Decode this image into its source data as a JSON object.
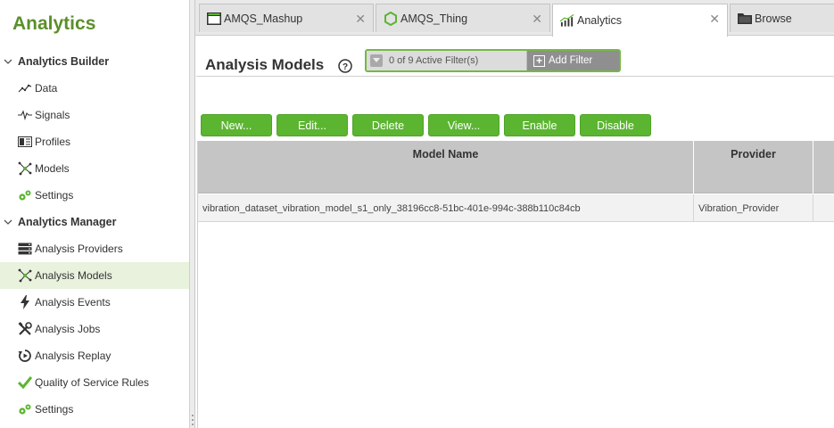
{
  "sidebar": {
    "title": "Analytics",
    "sections": [
      {
        "label": "Analytics Builder",
        "items": [
          {
            "label": "Data",
            "icon": "data-icon"
          },
          {
            "label": "Signals",
            "icon": "signals-icon"
          },
          {
            "label": "Profiles",
            "icon": "profiles-icon"
          },
          {
            "label": "Models",
            "icon": "models-icon"
          },
          {
            "label": "Settings",
            "icon": "settings-icon"
          }
        ]
      },
      {
        "label": "Analytics Manager",
        "items": [
          {
            "label": "Analysis Providers",
            "icon": "providers-icon"
          },
          {
            "label": "Analysis Models",
            "icon": "models-icon",
            "active": true
          },
          {
            "label": "Analysis Events",
            "icon": "lightning-icon"
          },
          {
            "label": "Analysis Jobs",
            "icon": "tools-icon"
          },
          {
            "label": "Analysis Replay",
            "icon": "replay-icon"
          },
          {
            "label": "Quality of Service Rules",
            "icon": "checkmark-icon"
          },
          {
            "label": "Settings",
            "icon": "settings-icon"
          }
        ]
      }
    ]
  },
  "tabs": [
    {
      "label": "AMQS_Mashup",
      "icon": "mashup-icon"
    },
    {
      "label": "AMQS_Thing",
      "icon": "thing-icon"
    },
    {
      "label": "Analytics",
      "icon": "analytics-icon",
      "active": true
    },
    {
      "label": "Browse",
      "icon": "folder-icon"
    }
  ],
  "page": {
    "title": "Analysis Models",
    "filter": {
      "count_text": "0 of 9 Active Filter(s)",
      "add_label": "Add Filter"
    },
    "buttons": {
      "new": "New...",
      "edit": "Edit...",
      "delete": "Delete",
      "view": "View...",
      "enable": "Enable",
      "disable": "Disable"
    },
    "grid": {
      "columns": [
        "Model Name",
        "Provider"
      ],
      "rows": [
        [
          "vibration_dataset_vibration_model_s1_only_38196cc8-51bc-401e-994c-388b110c84cb",
          "Vibration_Provider"
        ]
      ]
    }
  },
  "colors": {
    "brand_green": "#5b8f2a",
    "button_green": "#5cb531",
    "active_row": "#e8f2dc"
  }
}
